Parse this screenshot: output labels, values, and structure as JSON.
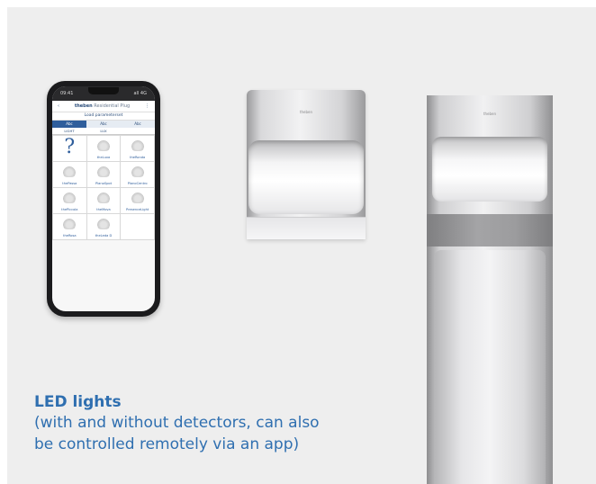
{
  "phone": {
    "status_time": "09:41",
    "status_signal": "all 4G",
    "app_brand": "theben",
    "app_name": "Residential Plug",
    "load_label": "Load parameterset",
    "tabs": [
      "Abc",
      "Abc",
      "Abc"
    ],
    "subtabs": [
      "LIGHT",
      "LUX"
    ],
    "grid_items": [
      {
        "label": "",
        "icon": "question-mark-icon"
      },
      {
        "label": "theLuxa",
        "icon": "detector-icon"
      },
      {
        "label": "theRonda",
        "icon": "detector-icon"
      },
      {
        "label": "thePassa",
        "icon": "detector-icon"
      },
      {
        "label": "PlanoSpot",
        "icon": "detector-icon"
      },
      {
        "label": "PlanoCentro",
        "icon": "detector-icon"
      },
      {
        "label": "thePiccola",
        "icon": "detector-icon"
      },
      {
        "label": "theMova",
        "icon": "detector-icon"
      },
      {
        "label": "PresenceLight",
        "icon": "detector-icon"
      },
      {
        "label": "theRosa",
        "icon": "detector-icon"
      },
      {
        "label": "theLeda D",
        "icon": "detector-icon"
      }
    ]
  },
  "lamps": {
    "wall_logo": "theben",
    "bollard_logo": "theben"
  },
  "caption": {
    "title": "LED lights",
    "line1": "(with and without detectors, can also",
    "line2": "be controlled remotely via an app)"
  }
}
